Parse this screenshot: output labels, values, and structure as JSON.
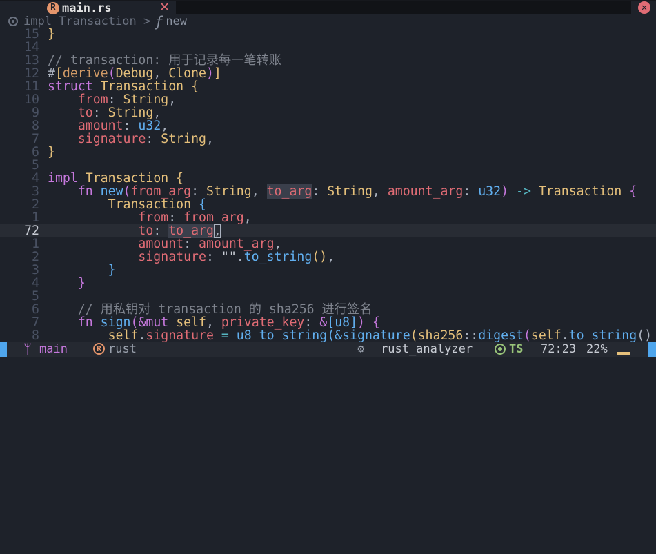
{
  "tab": {
    "filename": "main.rs",
    "file_icon": "rust-icon",
    "close_icon": "close-icon"
  },
  "window": {
    "close_icon": "close-circle-icon"
  },
  "breadcrumb": {
    "scope": "impl Transaction",
    "sep": ">",
    "fn_glyph": "ƒ",
    "item": "new"
  },
  "editor": {
    "lines": [
      {
        "n": "15",
        "t": [
          [
            "by",
            "}"
          ]
        ]
      },
      {
        "n": "14",
        "t": []
      },
      {
        "n": "13",
        "t": [
          [
            "cm",
            "// transaction: 用于记录每一笔转账"
          ]
        ]
      },
      {
        "n": "12",
        "t": [
          [
            "pl",
            "#"
          ],
          [
            "by",
            "["
          ],
          [
            "at",
            "derive"
          ],
          [
            "bp",
            "("
          ],
          [
            "ty",
            "Debug"
          ],
          [
            "pl",
            ", "
          ],
          [
            "ty",
            "Clone"
          ],
          [
            "bp",
            ")"
          ],
          [
            "by",
            "]"
          ]
        ]
      },
      {
        "n": "11",
        "t": [
          [
            "kw",
            "struct"
          ],
          [
            "pl",
            " "
          ],
          [
            "ty",
            "Transaction"
          ],
          [
            "pl",
            " "
          ],
          [
            "by",
            "{"
          ]
        ]
      },
      {
        "n": "10",
        "t": [
          [
            "pl",
            "    "
          ],
          [
            "fd",
            "from"
          ],
          [
            "pl",
            ": "
          ],
          [
            "ty",
            "String"
          ],
          [
            "pl",
            ","
          ]
        ]
      },
      {
        "n": "9",
        "t": [
          [
            "pl",
            "    "
          ],
          [
            "fd",
            "to"
          ],
          [
            "pl",
            ": "
          ],
          [
            "ty",
            "String"
          ],
          [
            "pl",
            ","
          ]
        ]
      },
      {
        "n": "8",
        "t": [
          [
            "pl",
            "    "
          ],
          [
            "fd",
            "amount"
          ],
          [
            "pl",
            ": "
          ],
          [
            "fn",
            "u32"
          ],
          [
            "pl",
            ","
          ]
        ]
      },
      {
        "n": "7",
        "t": [
          [
            "pl",
            "    "
          ],
          [
            "fd",
            "signature"
          ],
          [
            "pl",
            ": "
          ],
          [
            "ty",
            "String"
          ],
          [
            "pl",
            ","
          ]
        ]
      },
      {
        "n": "6",
        "t": [
          [
            "by",
            "}"
          ]
        ]
      },
      {
        "n": "5",
        "t": []
      },
      {
        "n": "4",
        "t": [
          [
            "kw",
            "impl"
          ],
          [
            "pl",
            " "
          ],
          [
            "ty",
            "Transaction"
          ],
          [
            "pl",
            " "
          ],
          [
            "by",
            "{"
          ]
        ]
      },
      {
        "n": "3",
        "t": [
          [
            "pl",
            "    "
          ],
          [
            "kw",
            "fn"
          ],
          [
            "pl",
            " "
          ],
          [
            "fn",
            "new"
          ],
          [
            "bp",
            "("
          ],
          [
            "fd",
            "from_arg"
          ],
          [
            "pl",
            ": "
          ],
          [
            "ty",
            "String"
          ],
          [
            "pl",
            ", "
          ],
          [
            "fd hl",
            "to_arg"
          ],
          [
            "pl",
            ": "
          ],
          [
            "ty",
            "String"
          ],
          [
            "pl",
            ", "
          ],
          [
            "fd",
            "amount_arg"
          ],
          [
            "pl",
            ": "
          ],
          [
            "fn",
            "u32"
          ],
          [
            "bp",
            ")"
          ],
          [
            "pl",
            " "
          ],
          [
            "op",
            "->"
          ],
          [
            "pl",
            " "
          ],
          [
            "ty",
            "Transaction"
          ],
          [
            "pl",
            " "
          ],
          [
            "bp",
            "{"
          ]
        ]
      },
      {
        "n": "2",
        "t": [
          [
            "pl",
            "        "
          ],
          [
            "ty",
            "Transaction"
          ],
          [
            "pl",
            " "
          ],
          [
            "bb",
            "{"
          ]
        ]
      },
      {
        "n": "1",
        "t": [
          [
            "pl",
            "            "
          ],
          [
            "fd",
            "from"
          ],
          [
            "pl",
            ": "
          ],
          [
            "fd",
            "from_arg"
          ],
          [
            "pl",
            ","
          ]
        ]
      },
      {
        "n": "72",
        "cur": true,
        "t": [
          [
            "pl",
            "            "
          ],
          [
            "fd",
            "to"
          ],
          [
            "pl",
            ": "
          ],
          [
            "fd hl",
            "to_arg"
          ],
          [
            "pl cursor",
            ","
          ]
        ]
      },
      {
        "n": "1",
        "t": [
          [
            "pl",
            "            "
          ],
          [
            "fd",
            "amount"
          ],
          [
            "pl",
            ": "
          ],
          [
            "fd",
            "amount_arg"
          ],
          [
            "pl",
            ","
          ]
        ]
      },
      {
        "n": "2",
        "t": [
          [
            "pl",
            "            "
          ],
          [
            "fd",
            "signature"
          ],
          [
            "pl",
            ": "
          ],
          [
            "st",
            "\"\""
          ],
          [
            "pl",
            "."
          ],
          [
            "fn",
            "to_string"
          ],
          [
            "by",
            "()"
          ],
          [
            "pl",
            ","
          ]
        ]
      },
      {
        "n": "3",
        "t": [
          [
            "pl",
            "        "
          ],
          [
            "bb",
            "}"
          ]
        ]
      },
      {
        "n": "4",
        "t": [
          [
            "pl",
            "    "
          ],
          [
            "bp",
            "}"
          ]
        ]
      },
      {
        "n": "5",
        "t": []
      },
      {
        "n": "6",
        "t": [
          [
            "pl",
            "    "
          ],
          [
            "cm",
            "// 用私钥对 transaction 的 sha256 进行签名"
          ]
        ]
      },
      {
        "n": "7",
        "t": [
          [
            "pl",
            "    "
          ],
          [
            "kw",
            "fn"
          ],
          [
            "pl",
            " "
          ],
          [
            "fn",
            "sign"
          ],
          [
            "bp",
            "("
          ],
          [
            "kw",
            "&mut"
          ],
          [
            "pl",
            " "
          ],
          [
            "ty",
            "self"
          ],
          [
            "pl",
            ", "
          ],
          [
            "fd",
            "private_key"
          ],
          [
            "pl",
            ": "
          ],
          [
            "kw",
            "&"
          ],
          [
            "bb",
            "["
          ],
          [
            "fn",
            "u8"
          ],
          [
            "bb",
            "]"
          ],
          [
            "bp",
            ")"
          ],
          [
            "pl",
            " "
          ],
          [
            "bp",
            "{"
          ]
        ]
      },
      {
        "n": "8",
        "t": [
          [
            "pl",
            "        "
          ],
          [
            "ty",
            "self"
          ],
          [
            "pl",
            "."
          ],
          [
            "fd",
            "signature"
          ],
          [
            "pl",
            " "
          ],
          [
            "op",
            "="
          ],
          [
            "pl",
            " "
          ],
          [
            "fn",
            "u8_to_string"
          ],
          [
            "bb",
            "("
          ],
          [
            "fn",
            "&signature"
          ],
          [
            "by",
            "("
          ],
          [
            "ty",
            "sha256"
          ],
          [
            "pl",
            "::"
          ],
          [
            "fn",
            "digest"
          ],
          [
            "bp",
            "("
          ],
          [
            "ty",
            "self"
          ],
          [
            "pl",
            "."
          ],
          [
            "fn",
            "to_string"
          ],
          [
            "pl",
            "()"
          ]
        ]
      }
    ]
  },
  "status": {
    "branch_icon": "git-branch-icon",
    "branch": "main",
    "lang_icon": "rust-icon",
    "language": "rust",
    "lsp_icon": "gear-icon",
    "lsp": "rust_analyzer",
    "ts_icon": "circle-icon",
    "ts": "TS",
    "position": "72:23",
    "percent": "22%",
    "accent": "#4fa6ed"
  }
}
